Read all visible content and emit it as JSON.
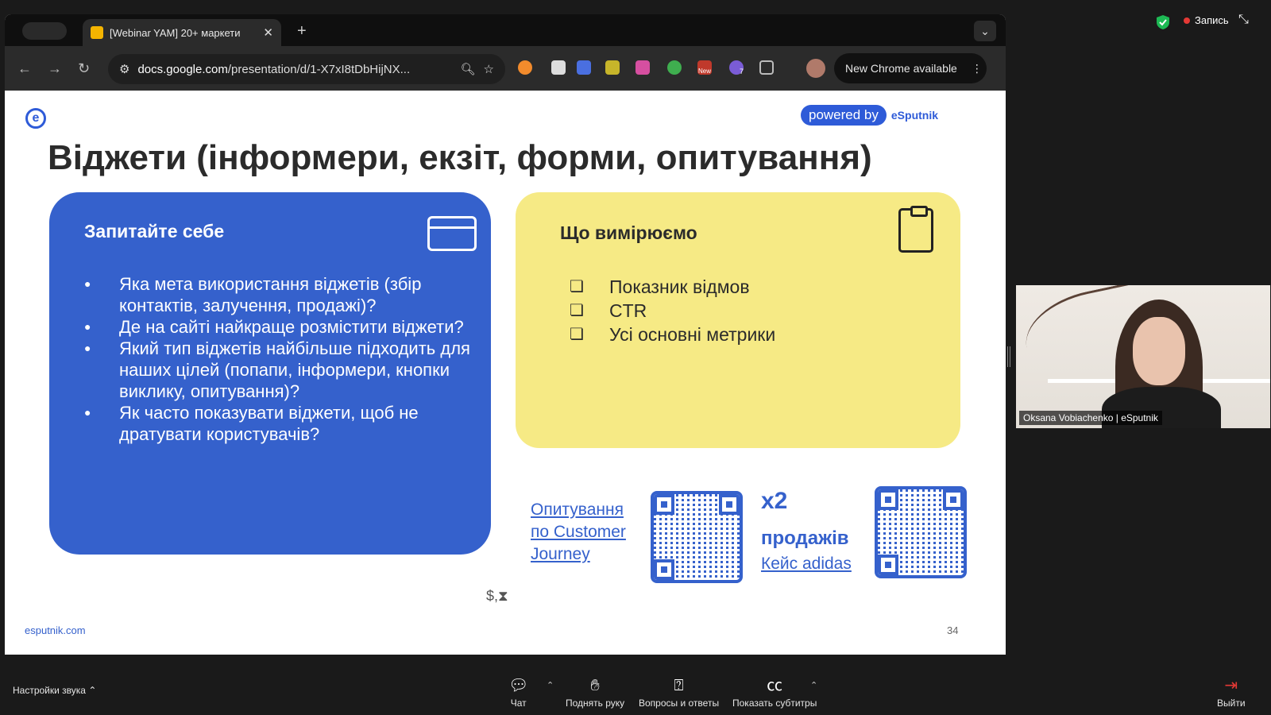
{
  "zoom": {
    "recording_label": "Запись",
    "audio_settings": "Настройки звука",
    "buttons": [
      {
        "label": "Чат",
        "icon": "chat-icon"
      },
      {
        "label": "Поднять руку",
        "icon": "raise-hand-icon"
      },
      {
        "label": "Вопросы и ответы",
        "icon": "qa-icon"
      },
      {
        "label": "Показать субтитры",
        "icon": "captions-icon"
      }
    ],
    "leave_label": "Выйти",
    "participant_name": "Oksana Vobiachenko | eSputnik"
  },
  "browser": {
    "tab_title": "[Webinar YAM] 20+ маркети",
    "url_host": "docs.google.com",
    "url_path": "/presentation/d/1-X7xI8tDbHijNX...",
    "new_chrome": "New Chrome available",
    "ext_badge_new": "New",
    "ext_badge_count": "7"
  },
  "slide": {
    "powered_by": "powered by",
    "brand": "eSputnik",
    "title": "Віджети (інформери, екзіт, форми, опитування)",
    "left_card": {
      "heading": "Запитайте себе",
      "bullets": [
        "Яка мета використання віджетів (збір контактів, залучення, продажі)?",
        "Де на сайті найкраще розмістити віджети?",
        "Який тип віджетів найбільше підходить для наших цілей (попапи, інформери, кнопки виклику, опитування)?",
        "Як часто показувати віджети, щоб не дратувати користувачів?"
      ]
    },
    "right_card": {
      "heading": "Що вимірюємо",
      "items": [
        "Показник відмов",
        "CTR",
        "Усі основні метрики"
      ]
    },
    "survey_link": "Опитування по Customer Journey",
    "x2": "x2",
    "sales": "продажів",
    "case_link": "Кейс adidas",
    "mark": "$,⧗",
    "footer_url": "esputnik.com",
    "page_number": "34"
  },
  "colors": {
    "slide_blue": "#3561cc",
    "slide_yellow": "#f6ea85",
    "record_red": "#e53935"
  }
}
